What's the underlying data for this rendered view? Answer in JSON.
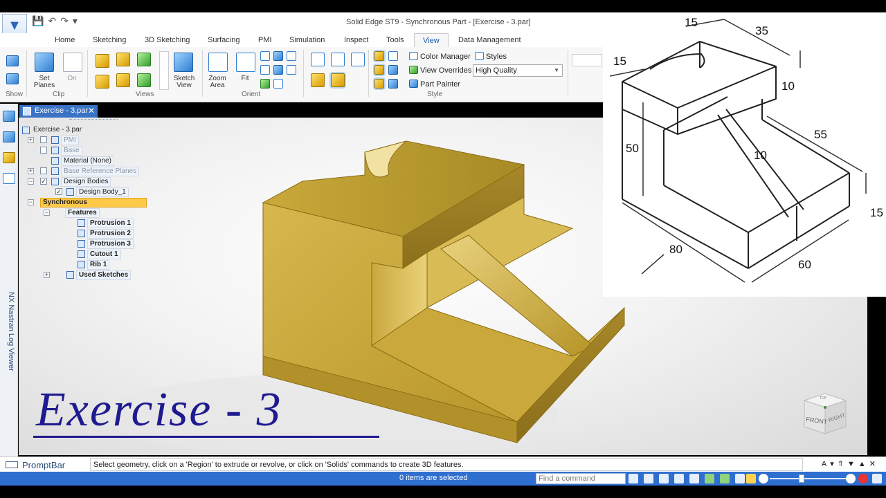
{
  "window": {
    "title": "Solid Edge ST9 - Synchronous Part - [Exercise - 3.par]"
  },
  "ribbon": {
    "tabs": [
      {
        "label": "Home"
      },
      {
        "label": "Sketching"
      },
      {
        "label": "3D Sketching"
      },
      {
        "label": "Surfacing"
      },
      {
        "label": "PMI"
      },
      {
        "label": "Simulation"
      },
      {
        "label": "Inspect"
      },
      {
        "label": "Tools"
      },
      {
        "label": "View"
      },
      {
        "label": "Data Management"
      }
    ],
    "active_tab": "View",
    "groups": {
      "show": "Show",
      "clip": "Clip",
      "views": "Views",
      "orient": "Orient",
      "style": "Style"
    },
    "buttons": {
      "set_planes": "Set Planes",
      "on": "On",
      "sketch_view": "Sketch View",
      "zoom_area": "Zoom Area",
      "fit": "Fit",
      "color_manager": "Color Manager",
      "styles": "Styles",
      "view_overrides": "View Overrides",
      "part_painter": "Part Painter",
      "render_quality": "High Quality"
    }
  },
  "document_tab": {
    "label": "Exercise - 3.par"
  },
  "pathfinder": {
    "root": "Exercise - 3.par",
    "items": [
      {
        "label": "PMI"
      },
      {
        "label": "Base"
      },
      {
        "label": "Material (None)"
      },
      {
        "label": "Base Reference Planes"
      },
      {
        "label": "Design Bodies"
      },
      {
        "label": "Design Body_1"
      },
      {
        "label": "Synchronous"
      },
      {
        "label": "Features"
      },
      {
        "label": "Protrusion 1"
      },
      {
        "label": "Protrusion 2"
      },
      {
        "label": "Protrusion 3"
      },
      {
        "label": "Cutout 1"
      },
      {
        "label": "Rib 1"
      },
      {
        "label": "Used Sketches"
      }
    ]
  },
  "side_panel": {
    "label": "NX Nastran Log Viewer"
  },
  "overlay": {
    "title": "Exercise - 3"
  },
  "view_cube": {
    "front": "FRONT",
    "right": "RIGHT",
    "top": "TOP"
  },
  "drawing": {
    "dims": [
      "15",
      "35",
      "15",
      "10",
      "50",
      "10",
      "55",
      "15",
      "80",
      "60"
    ]
  },
  "promptbar": {
    "label": "PromptBar",
    "message": "Select geometry, click on a 'Region' to extrude or revolve, or click on 'Solids' commands to create 3D features."
  },
  "statusbar": {
    "selection": "0 items are selected",
    "find_placeholder": "Find a command"
  },
  "colors": {
    "accent": "#2f6fcf",
    "model_gold": "#c9a93a",
    "title_text": "#1e1a8f"
  }
}
